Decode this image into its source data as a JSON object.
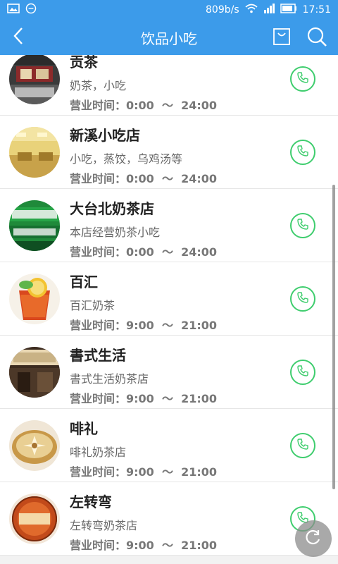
{
  "status_bar": {
    "speed": "809b/s",
    "time": "17:51",
    "icons": [
      "image-notification-icon",
      "chat-notification-icon",
      "wifi-icon",
      "signal-icon",
      "battery-icon"
    ]
  },
  "header": {
    "title": "饮品小吃",
    "back_icon": "chevron-left-icon",
    "bag_icon": "shopping-bag-icon",
    "search_icon": "search-icon"
  },
  "colors": {
    "accent": "#3c9bea",
    "call_green": "#3fcd6e"
  },
  "stores": [
    {
      "name": "贡茶",
      "desc": "奶茶，小吃",
      "hours": "营业时间：0:00  ～  24:00"
    },
    {
      "name": "新溪小吃店",
      "desc": "小吃，蒸饺，乌鸡汤等",
      "hours": "营业时间：0:00  ～  24:00"
    },
    {
      "name": "大台北奶茶店",
      "desc": "本店经营奶茶小吃",
      "hours": "营业时间：0:00  ～  24:00"
    },
    {
      "name": "百汇",
      "desc": "百汇奶茶",
      "hours": "营业时间：9:00  ～  21:00"
    },
    {
      "name": "書式生活",
      "desc": "書式生活奶茶店",
      "hours": "营业时间：9:00  ～  21:00"
    },
    {
      "name": "啡礼",
      "desc": "啡礼奶茶店",
      "hours": "营业时间：9:00  ～  21:00"
    },
    {
      "name": "左转弯",
      "desc": "左转弯奶茶店",
      "hours": "营业时间：9:00  ～  21:00"
    }
  ],
  "call_icon": "phone-icon",
  "float_icon": "refresh-icon"
}
